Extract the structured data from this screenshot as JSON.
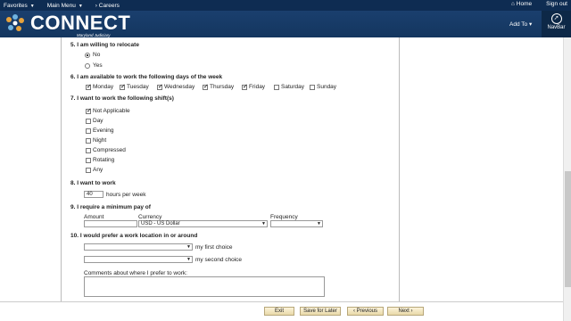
{
  "topbar": {
    "favorites": "Favorites",
    "main_menu": "Main Menu",
    "breadcrumb": "Careers",
    "home": "Home",
    "signout": "Sign out"
  },
  "banner": {
    "brand": "CONNECT",
    "subtitle": "Maryland Judiciary",
    "add_to": "Add To",
    "navbar": "NavBar"
  },
  "q5": {
    "label": "5. I am willing to relocate",
    "options": [
      "No",
      "Yes"
    ],
    "selected": "No"
  },
  "q6": {
    "label": "6. I am available to work the following days of the week",
    "days": [
      {
        "label": "Monday",
        "checked": true
      },
      {
        "label": "Tuesday",
        "checked": true
      },
      {
        "label": "Wednesday",
        "checked": true
      },
      {
        "label": "Thursday",
        "checked": true
      },
      {
        "label": "Friday",
        "checked": true
      },
      {
        "label": "Saturday",
        "checked": false
      },
      {
        "label": "Sunday",
        "checked": false
      }
    ]
  },
  "q7": {
    "label": "7. I want to work the following shift(s)",
    "shifts": [
      {
        "label": "Not Applicable",
        "checked": true
      },
      {
        "label": "Day",
        "checked": false
      },
      {
        "label": "Evening",
        "checked": false
      },
      {
        "label": "Night",
        "checked": false
      },
      {
        "label": "Compressed",
        "checked": false
      },
      {
        "label": "Rotating",
        "checked": false
      },
      {
        "label": "Any",
        "checked": false
      }
    ]
  },
  "q8": {
    "label": "8. I want to work",
    "hours_value": "40",
    "suffix": "hours per week"
  },
  "q9": {
    "label": "9. I require a minimum pay of",
    "amount_label": "Amount",
    "amount_value": "",
    "currency_label": "Currency",
    "currency_value": "USD - US Dollar",
    "frequency_label": "Frequency",
    "frequency_value": ""
  },
  "q10": {
    "label": "10. I would prefer a work location in or around",
    "first_value": "",
    "first_suffix": "my first choice",
    "second_value": "",
    "second_suffix": "my second choice",
    "comments_label": "Comments about where I prefer to work:",
    "comments_value": ""
  },
  "footer": {
    "exit": "Exit",
    "save_later": "Save for Later",
    "previous": "Previous",
    "next": "Next"
  }
}
